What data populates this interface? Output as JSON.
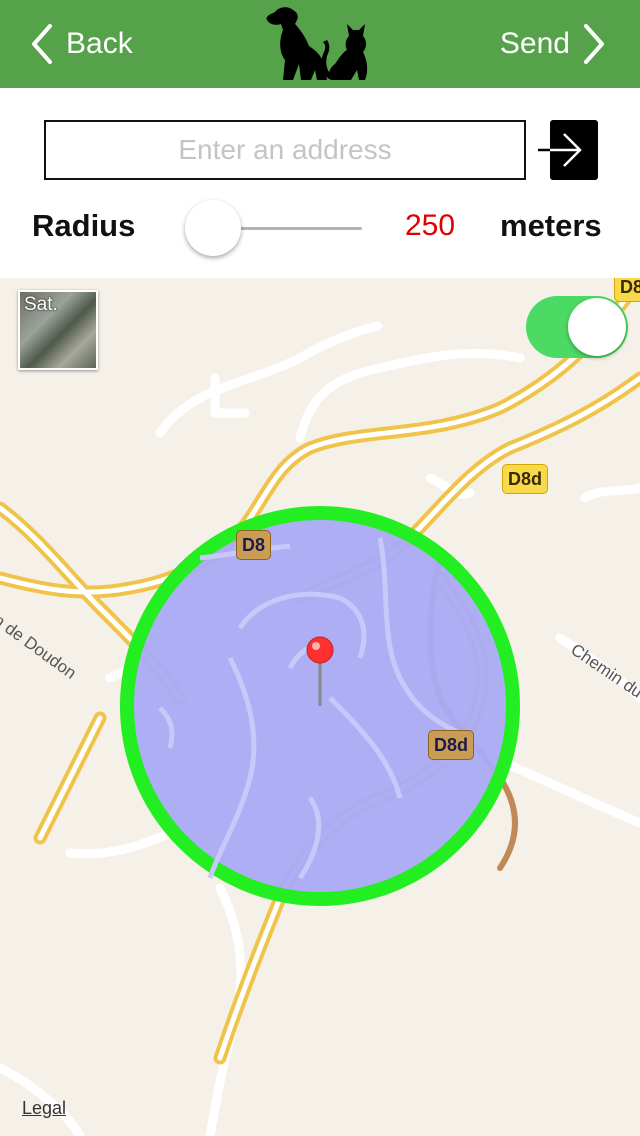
{
  "navbar": {
    "back_label": "Back",
    "send_label": "Send",
    "color": "#56a24a"
  },
  "search": {
    "placeholder": "Enter an address",
    "value": ""
  },
  "radius": {
    "label": "Radius",
    "value": "250",
    "unit": "meters",
    "slider_fraction": 0.0
  },
  "map": {
    "satellite_label": "Sat.",
    "overlay_toggle_on": true,
    "road_labels": [
      "D8",
      "D8d",
      "D8d",
      "D8"
    ],
    "street_labels": [
      "in de Doudon",
      "Chemin du"
    ],
    "legal_label": "Legal",
    "circle_fill": "#aaaaf5",
    "circle_stroke": "#22ee22",
    "pin_color": "#ff3030"
  }
}
